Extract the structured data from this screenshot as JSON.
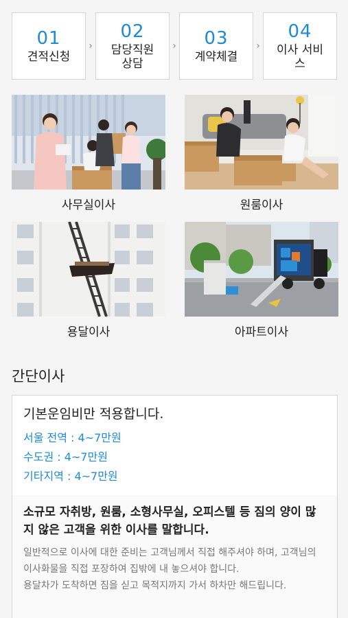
{
  "steps": [
    {
      "number": "01",
      "label": "견적신청"
    },
    {
      "number": "02",
      "label": "담당직원\n상담"
    },
    {
      "number": "03",
      "label": "계약체결"
    },
    {
      "number": "04",
      "label": "이사 서비\n스"
    }
  ],
  "step_arrow": "›",
  "services": [
    {
      "label": "사무실이사"
    },
    {
      "label": "원룸이사"
    },
    {
      "label": "용달이사"
    },
    {
      "label": "아파트이사"
    }
  ],
  "simple_move": {
    "title": "간단이사",
    "headline": "기본운임비만 적용합니다.",
    "prices": [
      "서울 전역 : 4~7만원",
      "수도권 : 4~7만원",
      "기타지역 : 4~7만원"
    ],
    "subheadline": "소규모 자취방, 원룸, 소형사무실, 오피스텔 등 짐의 양이 많지 않은 고객을 위한 이사를 말합니다.",
    "body_1": "일반적으로 이사에 대한 준비는 고객님께서 직접 해주셔야 하며, 고객님의 이사화물을 직접 포장하여 집밖에 내 놓으셔야 합니다.",
    "body_2": "용달차가 도착하면 짐을 싣고 목적지까지 가서 하차만 해드립니다."
  },
  "colors": {
    "accent": "#1d8ad6",
    "card_border": "#d4d4d4",
    "background": "#f5f5f5"
  }
}
